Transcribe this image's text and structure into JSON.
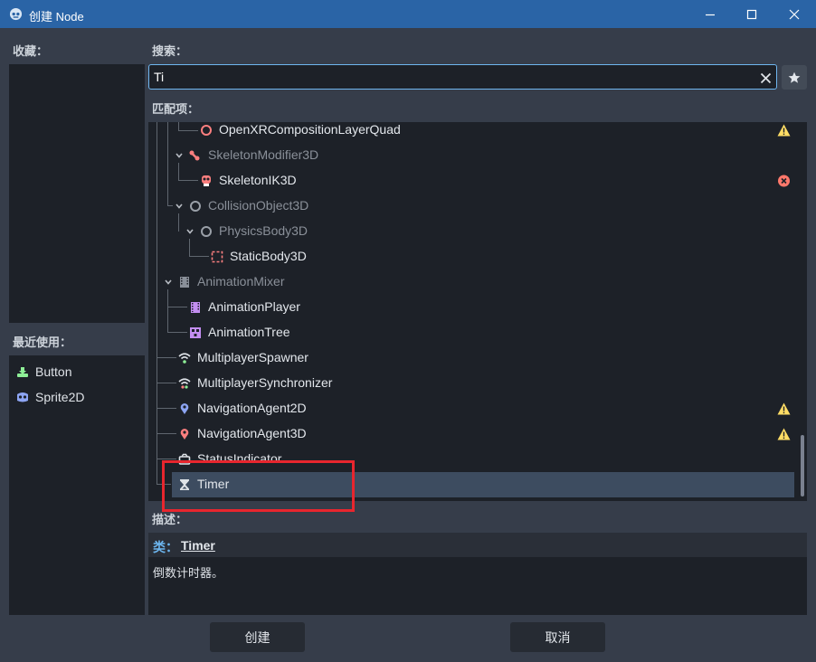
{
  "window": {
    "title": "创建 Node",
    "controls": [
      "minimize-icon",
      "maximize-icon",
      "close-icon"
    ]
  },
  "favorites": {
    "label": "收藏："
  },
  "recent": {
    "label": "最近使用：",
    "items": [
      {
        "label": "Button",
        "icon": "button-node-icon",
        "color": "#8eef97"
      },
      {
        "label": "Sprite2D",
        "icon": "sprite2d-node-icon",
        "color": "#8da5f3"
      }
    ]
  },
  "search": {
    "label": "搜索：",
    "value": "Ti",
    "clear_icon": "close-icon",
    "favorite_icon": "star-icon"
  },
  "matches": {
    "label": "匹配项：",
    "rows": [
      {
        "label": "OpenXRCompositionLayerQuad",
        "icon": "node3d-circle-icon",
        "dim": false,
        "badge": "warning-icon"
      },
      {
        "label": "SkeletonModifier3D",
        "icon": "bone-icon",
        "dim": true,
        "expanded": true
      },
      {
        "label": "SkeletonIK3D",
        "icon": "skeleton-ik-icon",
        "dim": false,
        "badge": "error-icon"
      },
      {
        "label": "CollisionObject3D",
        "icon": "node3d-circle-icon",
        "dim": true,
        "expanded": true
      },
      {
        "label": "PhysicsBody3D",
        "icon": "node3d-circle-icon",
        "dim": true,
        "expanded": true
      },
      {
        "label": "StaticBody3D",
        "icon": "static-body-icon",
        "dim": false
      },
      {
        "label": "AnimationMixer",
        "icon": "film-icon",
        "dim": true,
        "expanded": true
      },
      {
        "label": "AnimationPlayer",
        "icon": "animation-player-icon",
        "dim": false
      },
      {
        "label": "AnimationTree",
        "icon": "animation-tree-icon",
        "dim": false
      },
      {
        "label": "MultiplayerSpawner",
        "icon": "wifi-icon",
        "dim": false
      },
      {
        "label": "MultiplayerSynchronizer",
        "icon": "wifi-sync-icon",
        "dim": false
      },
      {
        "label": "NavigationAgent2D",
        "icon": "map-pin-2d-icon",
        "dim": false,
        "badge": "warning-icon"
      },
      {
        "label": "NavigationAgent3D",
        "icon": "map-pin-3d-icon",
        "dim": false,
        "badge": "warning-icon"
      },
      {
        "label": "StatusIndicator",
        "icon": "status-tray-icon",
        "dim": false
      },
      {
        "label": "Timer",
        "icon": "hourglass-icon",
        "dim": false,
        "selected": true
      }
    ]
  },
  "description": {
    "label": "描述：",
    "class_label": "类：",
    "class_name": "Timer",
    "text": "倒数计时器。"
  },
  "buttons": {
    "create": "创建",
    "cancel": "取消"
  },
  "colors": {
    "titlebar": "#2a64a6",
    "panel_bg": "#363d4a",
    "field_bg": "#1d2128",
    "accent": "#6cb5ee",
    "selection": "#3d4c60",
    "warning": "#ffdd65",
    "error": "#ff786b",
    "highlight_box": "#e8262e"
  }
}
